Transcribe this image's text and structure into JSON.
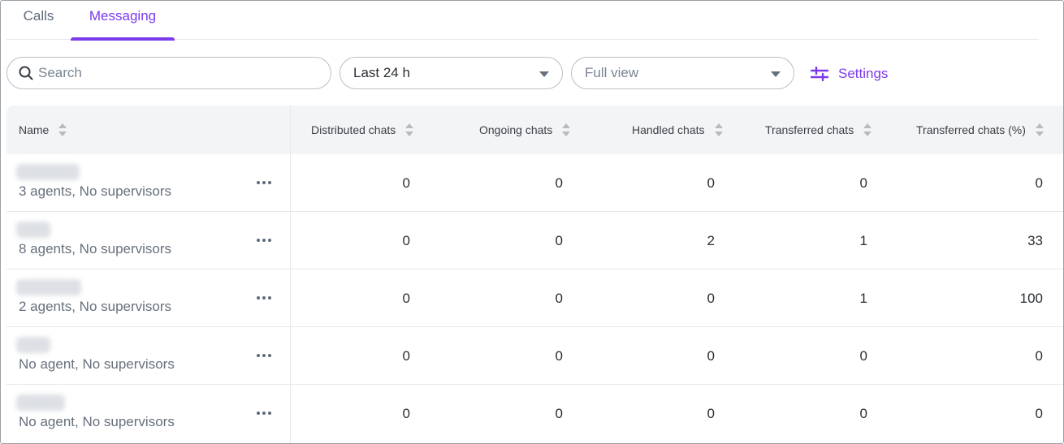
{
  "tabs": [
    {
      "label": "Calls"
    },
    {
      "label": "Messaging"
    }
  ],
  "toolbar": {
    "search_placeholder": "Search",
    "period_value": "Last 24 h",
    "view_value": "Full view",
    "settings_label": "Settings"
  },
  "table": {
    "columns": [
      "Name",
      "Distributed chats",
      "Ongoing chats",
      "Handled chats",
      "Transferred chats",
      "Transferred chats (%)"
    ],
    "rows": [
      {
        "subtitle": "3 agents, No supervisors",
        "values": [
          "0",
          "0",
          "0",
          "0",
          "0"
        ]
      },
      {
        "subtitle": "8 agents, No supervisors",
        "values": [
          "0",
          "0",
          "2",
          "1",
          "33"
        ]
      },
      {
        "subtitle": "2 agents, No supervisors",
        "values": [
          "0",
          "0",
          "0",
          "1",
          "100"
        ]
      },
      {
        "subtitle": "No agent, No supervisors",
        "values": [
          "0",
          "0",
          "0",
          "0",
          "0"
        ]
      },
      {
        "subtitle": "No agent, No supervisors",
        "values": [
          "0",
          "0",
          "0",
          "0",
          "0"
        ]
      }
    ]
  },
  "colors": {
    "accent": "#7c3aed",
    "header_bg": "#f3f4f6"
  }
}
